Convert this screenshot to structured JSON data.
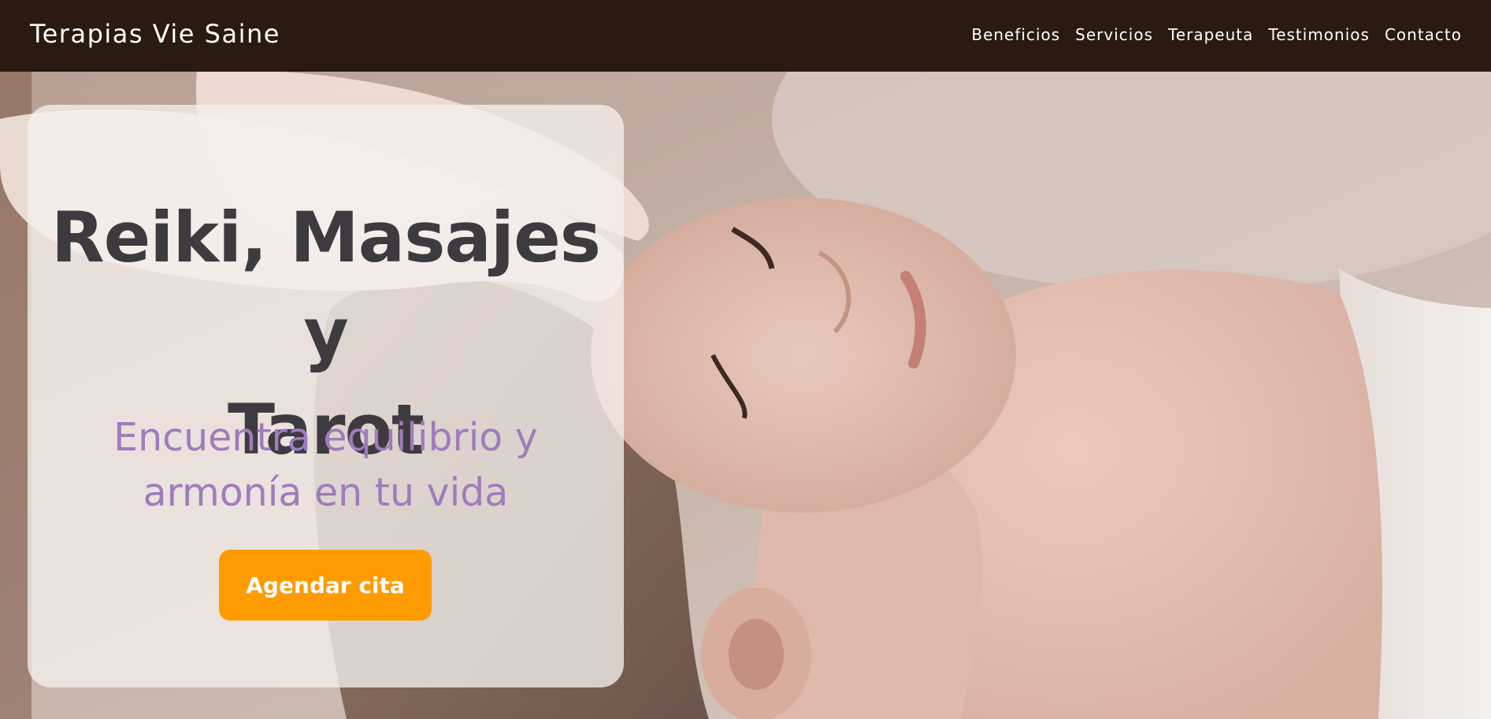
{
  "header": {
    "brand": "Terapias Vie Saine",
    "nav": [
      {
        "label": "Beneficios"
      },
      {
        "label": "Servicios"
      },
      {
        "label": "Terapeuta"
      },
      {
        "label": "Testimonios"
      },
      {
        "label": "Contacto"
      }
    ]
  },
  "hero": {
    "title_lines": [
      "Reiki, Masajes y",
      "Tarot"
    ],
    "subtitle_lines": [
      "Encuentra equilibrio y",
      "armonía en tu vida"
    ],
    "cta_label": "Agendar cita",
    "background_image": "woman-receiving-reiki-photo"
  },
  "colors": {
    "nav_background": "#2a1a10",
    "title": "#3d3b3f",
    "subtitle": "#a07bbd",
    "cta": "#fe9b00"
  }
}
